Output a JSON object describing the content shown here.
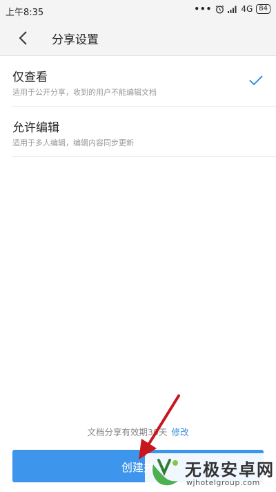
{
  "status_bar": {
    "time": "上午8:35",
    "dots": "•••",
    "network": "4G",
    "battery": "84"
  },
  "header": {
    "title": "分享设置"
  },
  "options": [
    {
      "label": "仅查看",
      "description": "适用于公开分享，收到的用户不能编辑文档",
      "selected": true
    },
    {
      "label": "允许编辑",
      "description": "适用于多人编辑，编辑内容同步更新",
      "selected": false
    }
  ],
  "footer": {
    "note": "文档分享有效期30天",
    "modify_label": "修改"
  },
  "create_button": {
    "label": "创建并"
  },
  "watermark": {
    "title": "无极安卓网",
    "url": "wjhotelgroup.com"
  },
  "colors": {
    "accent": "#3d95ec",
    "arrow": "#c8161d"
  }
}
